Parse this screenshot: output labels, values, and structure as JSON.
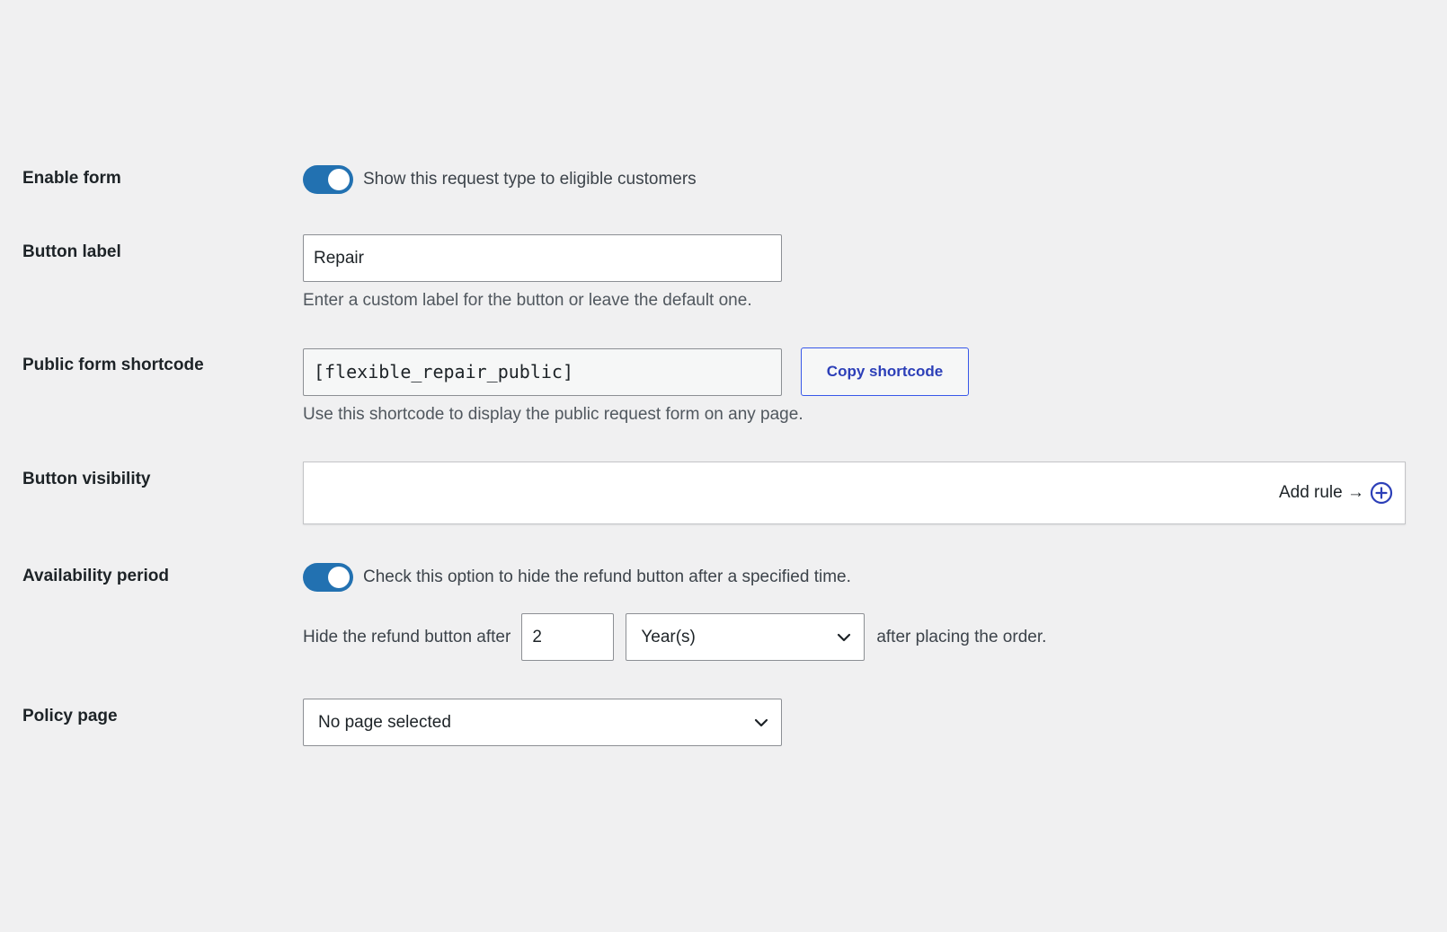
{
  "colors": {
    "toggle_on": "#2271b1",
    "link_blue": "#2c3fb8",
    "background": "#f0f0f1"
  },
  "enable_form": {
    "label": "Enable form",
    "toggle_state": "on",
    "toggle_text": "Show this request type to eligible customers"
  },
  "button_label": {
    "label": "Button label",
    "value": "Repair",
    "help": "Enter a custom label for the button or leave the default one."
  },
  "shortcode": {
    "label": "Public form shortcode",
    "value": "[flexible_repair_public]",
    "copy_button": "Copy shortcode",
    "help": "Use this shortcode to display the public request form on any page."
  },
  "button_visibility": {
    "label": "Button visibility",
    "add_rule": "Add rule →",
    "add_icon": "plus-circle-icon"
  },
  "availability": {
    "label": "Availability period",
    "toggle_state": "on",
    "toggle_text": "Check this option to hide the refund button after a specified time.",
    "prefix": "Hide the refund button after",
    "number": "2",
    "unit": "Year(s)",
    "suffix": "after placing the order."
  },
  "policy_page": {
    "label": "Policy page",
    "selected": "No page selected"
  }
}
